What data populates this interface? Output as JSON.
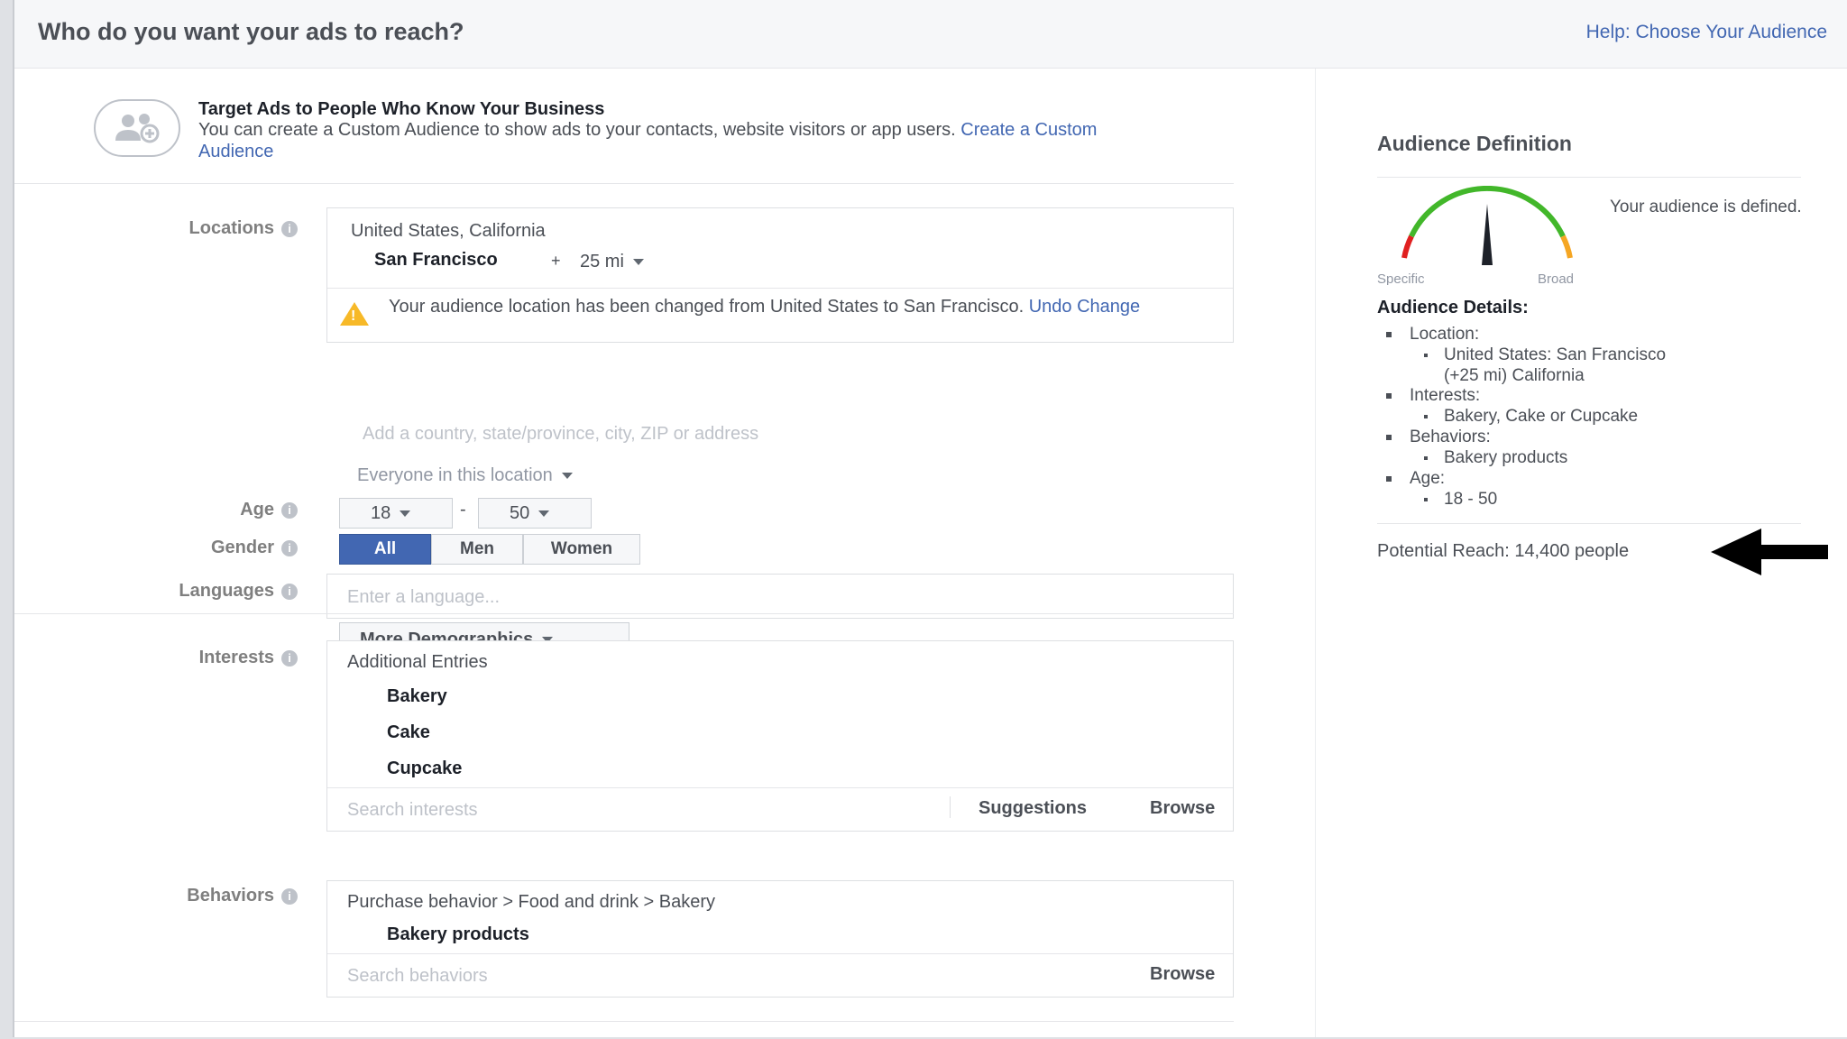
{
  "header": {
    "title": "Who do you want your ads to reach?",
    "help_link": "Help: Choose Your Audience"
  },
  "custom_audience": {
    "icon": "people-icon",
    "title": "Target Ads to People Who Know Your Business",
    "desc_prefix": "You can create a Custom Audience to show ads to your contacts, website visitors or app users. ",
    "link": "Create a Custom Audience"
  },
  "locations": {
    "label": "Locations",
    "country": "United States, California",
    "city": "San Francisco",
    "plus": "+",
    "radius": "25 mi",
    "warning_prefix": "Your audience location has been changed from United States to San Francisco. ",
    "undo_link": "Undo Change",
    "input_placeholder": "Add a country, state/province, city, ZIP or address",
    "scope": "Everyone in this location"
  },
  "age": {
    "label": "Age",
    "min": "18",
    "dash": "-",
    "max": "50"
  },
  "gender": {
    "label": "Gender",
    "options": [
      "All",
      "Men",
      "Women"
    ],
    "selected": "All"
  },
  "languages": {
    "label": "Languages",
    "placeholder": "Enter a language..."
  },
  "more_demographics": "More Demographics",
  "interests": {
    "label": "Interests",
    "heading": "Additional Entries",
    "items": [
      "Bakery",
      "Cake",
      "Cupcake"
    ],
    "search_placeholder": "Search interests",
    "suggestions": "Suggestions",
    "browse": "Browse"
  },
  "behaviors": {
    "label": "Behaviors",
    "path": "Purchase behavior > Food and drink > Bakery",
    "item": "Bakery products",
    "search_placeholder": "Search behaviors",
    "browse": "Browse"
  },
  "audience_definition": {
    "title": "Audience Definition",
    "gauge_left": "Specific",
    "gauge_right": "Broad",
    "gauge_level": 0.5,
    "status": "Your audience is defined.",
    "details_title": "Audience Details:",
    "location_label": "Location:",
    "location_value_line1": "United States: San Francisco",
    "location_value_line2": "(+25 mi) California",
    "interests_label": "Interests:",
    "interests_value": "Bakery, Cake or Cupcake",
    "behaviors_label": "Behaviors:",
    "behaviors_value": "Bakery products",
    "age_label": "Age:",
    "age_value": "18 - 50",
    "potential_reach": "Potential Reach: 14,400 people"
  },
  "colors": {
    "accent": "#4267b2",
    "warning": "#f7b928",
    "gauge_green": "#42b72a",
    "gauge_red": "#e02020",
    "gauge_orange": "#f5a623"
  }
}
